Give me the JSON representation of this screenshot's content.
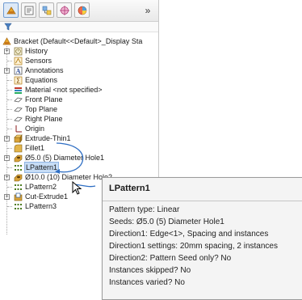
{
  "toolbar": {
    "buttons": [
      {
        "icon": "feature-manager-icon"
      },
      {
        "icon": "property-manager-icon"
      },
      {
        "icon": "configuration-manager-icon"
      },
      {
        "icon": "dimxpert-manager-icon"
      },
      {
        "icon": "display-manager-icon"
      }
    ],
    "expand_label": "»"
  },
  "tree": {
    "root": "Bracket  (Default<<Default>_Display Sta",
    "items": [
      {
        "label": "History",
        "icon": "history-icon"
      },
      {
        "label": "Sensors",
        "icon": "sensors-icon"
      },
      {
        "label": "Annotations",
        "icon": "annotations-icon"
      },
      {
        "label": "Equations",
        "icon": "equations-icon"
      },
      {
        "label": "Material <not specified>",
        "icon": "material-icon"
      },
      {
        "label": "Front Plane",
        "icon": "plane-icon"
      },
      {
        "label": "Top Plane",
        "icon": "plane-icon"
      },
      {
        "label": "Right Plane",
        "icon": "plane-icon"
      },
      {
        "label": "Origin",
        "icon": "origin-icon"
      },
      {
        "label": "Extrude-Thin1",
        "icon": "extrude-icon"
      },
      {
        "label": "Fillet1",
        "icon": "fillet-icon"
      },
      {
        "label": "Ø5.0 (5) Diameter Hole1",
        "icon": "hole-icon"
      },
      {
        "label": "LPattern1",
        "icon": "linear-pattern-icon"
      },
      {
        "label": "Ø10.0 (10) Diameter Hole2",
        "icon": "hole-icon"
      },
      {
        "label": "LPattern2",
        "icon": "linear-pattern-icon"
      },
      {
        "label": "Cut-Extrude1",
        "icon": "cut-extrude-icon"
      },
      {
        "label": "LPattern3",
        "icon": "linear-pattern-icon"
      }
    ]
  },
  "tooltip": {
    "title": "LPattern1",
    "lines": [
      "Pattern type: Linear",
      "Seeds: Ø5.0 (5) Diameter Hole1",
      "Direction1: Edge<1>, Spacing and instances",
      "Direction1 settings: 20mm spacing, 2 instances",
      "Direction2: Pattern Seed only? No",
      "Instances skipped? No",
      "Instances varied? No"
    ]
  },
  "colors": {
    "selection": "#c6dcf5",
    "arrow": "#2f6fc4",
    "tooltip_bg": "#f4f4f4"
  }
}
